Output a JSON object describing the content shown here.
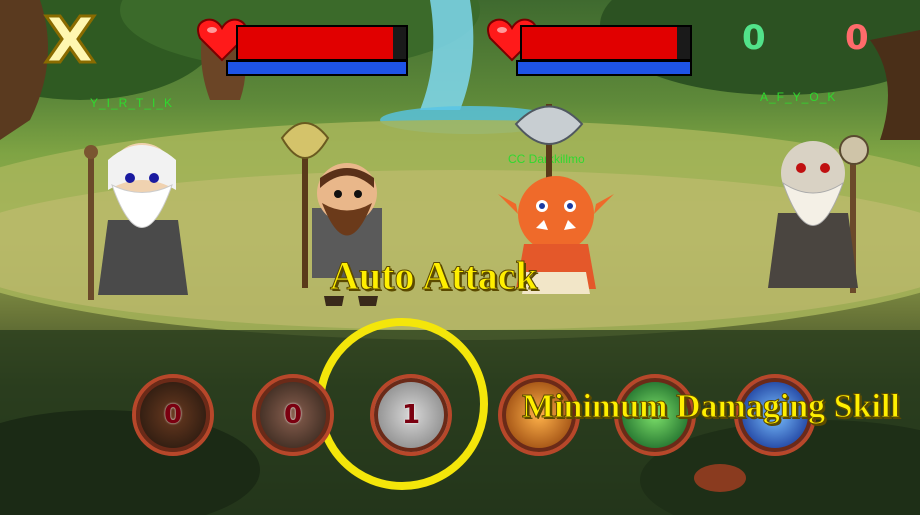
{
  "hud": {
    "player1": {
      "hp": 0.92,
      "mp": 1.0
    },
    "player2": {
      "hp": 0.92,
      "mp": 1.0
    },
    "score_left": "0",
    "score_right": "0",
    "colors": {
      "hp": "#e10000",
      "mp": "#1e54e6",
      "score_left": "#52e38a",
      "score_right": "#ff6b6b"
    }
  },
  "players": {
    "left_name": "Y_I_R_T_I_K",
    "enemy_name": "CC Darkkillmo",
    "right_name": "A_F_Y_O_K",
    "name_color": "#2fd92f"
  },
  "annotations": {
    "auto_attack": "Auto Attack",
    "min_skill": "Minimum Damaging Skill"
  },
  "skills": [
    {
      "name": "claw-skill",
      "value": "0"
    },
    {
      "name": "strike-skill",
      "value": "0"
    },
    {
      "name": "auto-attack-skill",
      "value": "1"
    },
    {
      "name": "fire-skill",
      "value": ""
    },
    {
      "name": "poison-skill",
      "value": ""
    },
    {
      "name": "water-skill",
      "value": ""
    }
  ],
  "icons": {
    "close": "close-x-icon",
    "heart": "heart-icon"
  }
}
